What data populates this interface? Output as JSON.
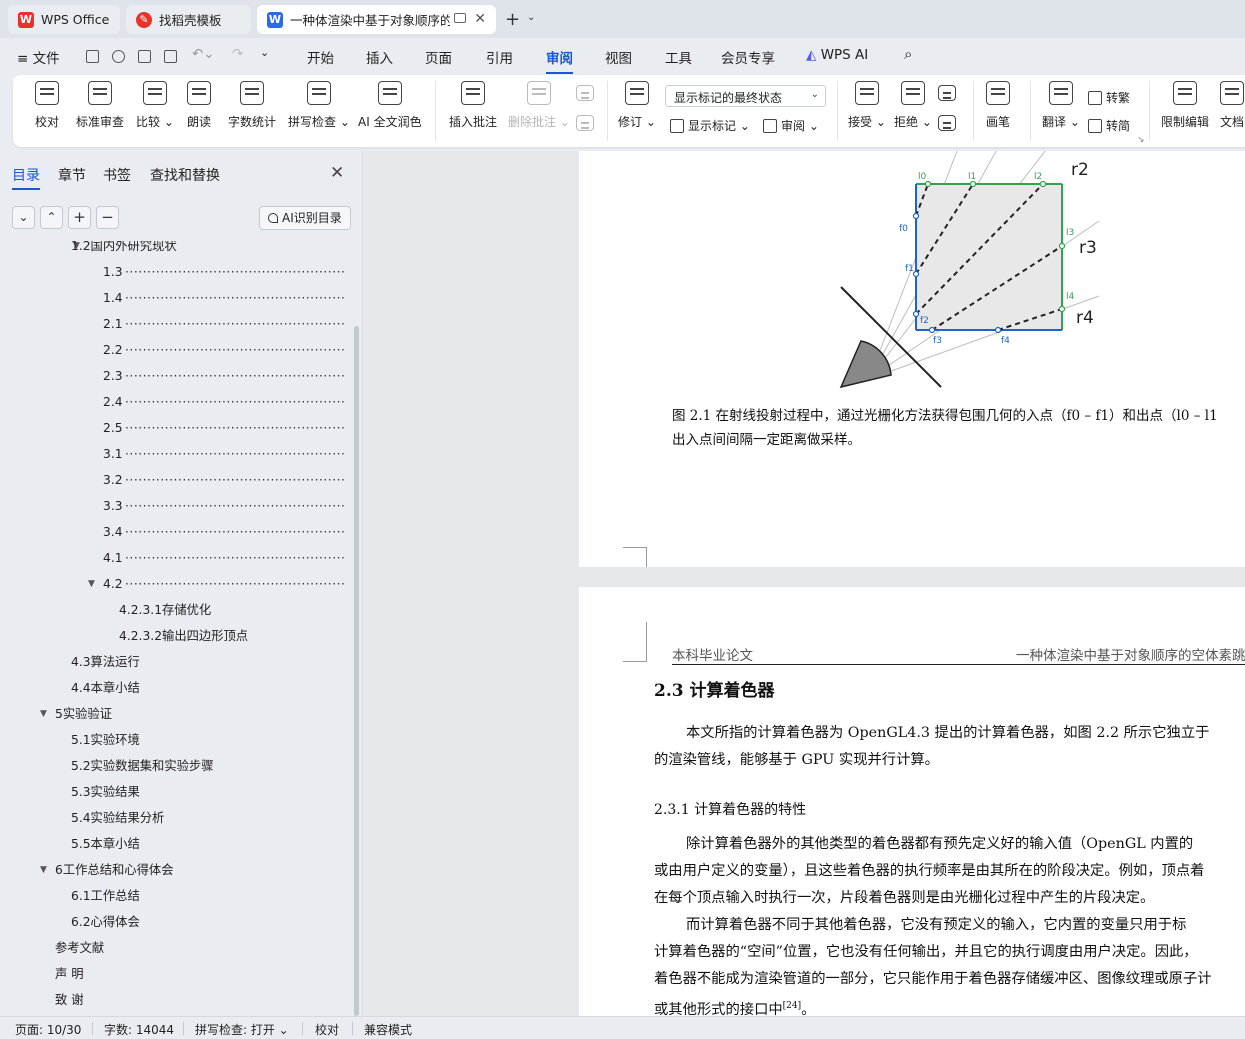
{
  "tabs": [
    {
      "label": "WPS Office",
      "icon": "wps-logo-icon"
    },
    {
      "label": "找稻壳模板",
      "icon": "docer-icon"
    },
    {
      "label": "一种体渲染中基于对象顺序的空体素跳过方法",
      "icon": "word-doc-icon"
    }
  ],
  "menu": {
    "file": "文件",
    "items": [
      "开始",
      "插入",
      "页面",
      "引用",
      "审阅",
      "视图",
      "工具",
      "会员专享"
    ],
    "active": "审阅",
    "wps_ai": "WPS AI"
  },
  "ribbon": {
    "proofread": "校对",
    "standard_review": "标准审查",
    "compare": "比较",
    "read_aloud": "朗读",
    "word_count": "字数统计",
    "spell_check": "拼写检查",
    "ai_polish": "AI 全文润色",
    "insert_comment": "插入批注",
    "delete_comment": "删除批注",
    "track_changes": "修订",
    "markup_state": "显示标记的最终状态",
    "show_markup": "显示标记",
    "review": "审阅",
    "accept": "接受",
    "reject": "拒绝",
    "pen": "画笔",
    "translate": "翻译",
    "to_traditional": "转繁",
    "to_simplified": "转简",
    "restrict_edit": "限制编辑",
    "doc_partial": "文档"
  },
  "nav": {
    "tabs": [
      "目录",
      "章节",
      "书签",
      "查找和替换"
    ],
    "ai_toc": "AI识别目录",
    "toc": [
      {
        "label": "1.2国内外研究现状",
        "level": 1,
        "arrow": "down",
        "dots": false
      },
      {
        "label": "1.3",
        "level": 2,
        "dots": true
      },
      {
        "label": "1.4",
        "level": 2,
        "dots": true
      },
      {
        "label": "2.1",
        "level": 2,
        "dots": true
      },
      {
        "label": "2.2",
        "level": 2,
        "dots": true
      },
      {
        "label": "2.3",
        "level": 2,
        "dots": true
      },
      {
        "label": "2.4",
        "level": 2,
        "dots": true
      },
      {
        "label": "2.5",
        "level": 2,
        "dots": true
      },
      {
        "label": "3.1",
        "level": 2,
        "dots": true
      },
      {
        "label": "3.2",
        "level": 2,
        "dots": true
      },
      {
        "label": "3.3",
        "level": 2,
        "dots": true
      },
      {
        "label": "3.4",
        "level": 2,
        "dots": true
      },
      {
        "label": "4.1",
        "level": 2,
        "dots": true
      },
      {
        "label": "4.2",
        "level": 2,
        "arrow": "down",
        "dots": true
      },
      {
        "label": "4.2.3.1存储优化",
        "level": 3,
        "dots": false
      },
      {
        "label": "4.2.3.2输出四边形顶点",
        "level": 3,
        "dots": false
      },
      {
        "label": "4.3算法运行",
        "level": 1,
        "dots": false
      },
      {
        "label": "4.4本章小结",
        "level": 1,
        "dots": false
      },
      {
        "label": "5实验验证",
        "level": 0,
        "arrow": "down",
        "dots": false
      },
      {
        "label": "5.1实验环境",
        "level": 1,
        "dots": false
      },
      {
        "label": "5.2实验数据集和实验步骤",
        "level": 1,
        "dots": false
      },
      {
        "label": "5.3实验结果",
        "level": 1,
        "dots": false
      },
      {
        "label": "5.4实验结果分析",
        "level": 1,
        "dots": false
      },
      {
        "label": "5.5本章小结",
        "level": 1,
        "dots": false
      },
      {
        "label": "6工作总结和心得体会",
        "level": 0,
        "arrow": "down",
        "dots": false
      },
      {
        "label": "6.1工作总结",
        "level": 1,
        "dots": false
      },
      {
        "label": "6.2心得体会",
        "level": 1,
        "dots": false
      },
      {
        "label": "参考文献",
        "level": 0,
        "dots": false
      },
      {
        "label": "声 明",
        "level": 0,
        "dots": false
      },
      {
        "label": "致 谢",
        "level": 0,
        "dots": false
      }
    ]
  },
  "doc": {
    "figure_labels": {
      "r2": "r2",
      "r3": "r3",
      "r4": "r4",
      "l0": "l0",
      "l1": "l1",
      "l2": "l2",
      "l3": "l3",
      "l4": "l4",
      "f0": "f0",
      "f1": "f1",
      "f2": "f2",
      "f3": "f3",
      "f4": "f4"
    },
    "caption_line1": "图 2.1   在射线投射过程中，通过光栅化方法获得包围几何的入点（f0 – f1）和出点（l0 – l1",
    "caption_line2": "出入点间间隔一定距离做采样。",
    "header_left": "本科毕业论文",
    "header_right": "一种体渲染中基于对象顺序的空体素跳",
    "section_title": "2.3   计算着色器",
    "paragraph1": [
      "本文所指的计算着色器为  OpenGL4.3 提出的计算着色器，如图  2.2 所示它独立于",
      "的渲染管线，能够基于  GPU 实现并行计算。"
    ],
    "subsection_title": "2.3.1   计算着色器的特性",
    "paragraph2": [
      "除计算着色器外的其他类型的着色器都有预先定义好的输入值（OpenGL 内置的",
      "或由用户定义的变量），且这些着色器的执行频率是由其所在的阶段决定。例如，顶点着",
      "在每个顶点输入时执行一次，片段着色器则是由光栅化过程中产生的片段决定。"
    ],
    "paragraph3": [
      "而计算着色器不同于其他着色器，它没有预定义的输入，它内置的变量只用于标",
      "计算着色器的“空间”位置，它也没有任何输出，并且它的执行调度由用户决定。因此，",
      "着色器不能成为渲染管道的一部分，它只能作用于着色器存储缓冲区、图像纹理或原子计",
      "或其他形式的接口中"
    ],
    "citation": "[24]",
    "end_mark": "。"
  },
  "status": {
    "page": "页面: 10/30",
    "words": "字数: 14044",
    "spell": "拼写检查: 打开",
    "proof": "校对",
    "compat": "兼容模式"
  },
  "colors": {
    "accent": "#1857d6",
    "figure_blue": "#1c64c8",
    "figure_green": "#2ea44f"
  }
}
